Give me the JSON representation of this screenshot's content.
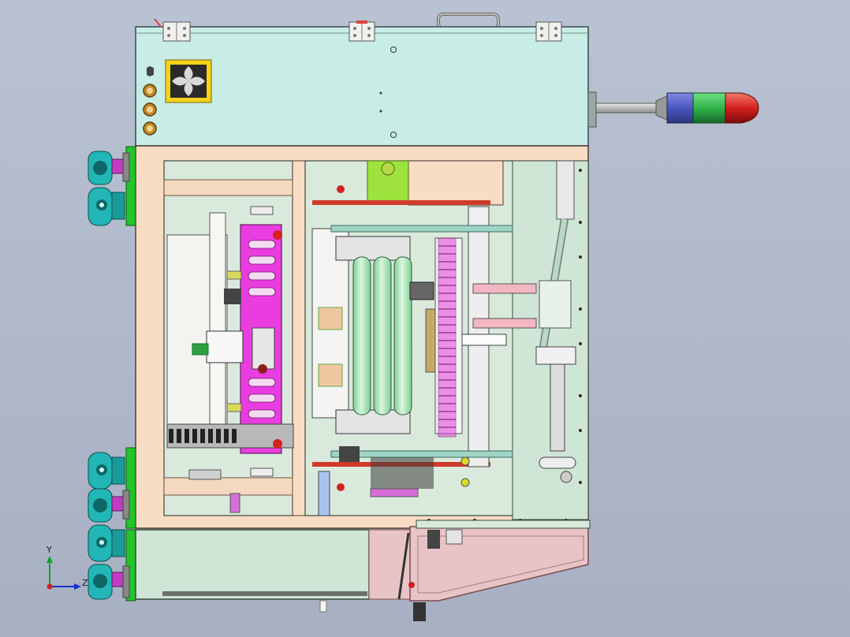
{
  "viewport": {
    "background_top": "#b9c2d2",
    "background_bottom": "#a7b0c2"
  },
  "model": {
    "colors": {
      "upper_cabinet": "#c8ece6",
      "frame_peach": "#f9dcc4",
      "inner_panel": "#d9eadc",
      "right_panel": "#cfe5d6",
      "green_side": "#23c42a",
      "pink_plate": "#e93de0",
      "roller": "#a6e6b4",
      "lime_block": "#9ee33d",
      "pink_hopper": "#e9c4c7",
      "caster_cyan": "#22b6b6",
      "caster_magenta": "#c23bc2",
      "vent_yellow": "#f4d21c",
      "lamp_blue": "#5561c8",
      "lamp_green": "#2fb34a",
      "lamp_red": "#d42020"
    },
    "signal_tower": [
      "blue",
      "green",
      "red"
    ],
    "icons": [
      "vent-grille-icon",
      "hinge-icon",
      "handle-icon",
      "caster-wheel-icon",
      "signal-tower-icon",
      "pneumatic-cylinder-icon"
    ]
  },
  "triad": {
    "y_label": "Y",
    "z_label": "Z"
  }
}
